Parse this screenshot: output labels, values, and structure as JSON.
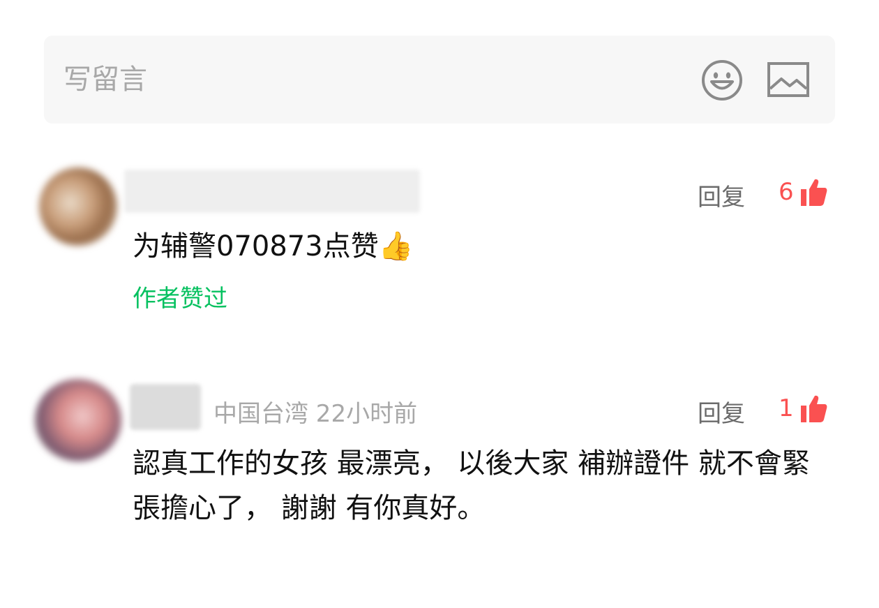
{
  "compose": {
    "placeholder": "写留言",
    "emoji_icon": "smiley-face-icon",
    "image_icon": "picture-icon"
  },
  "comments": [
    {
      "text": "为辅警070873点赞👍",
      "reply_label": "回复",
      "like_count": "6",
      "author_liked_label": "作者赞过"
    },
    {
      "location_time": "中国台湾 22小时前",
      "text": "認真工作的女孩 最漂亮， 以後大家 補辦證件 就不會緊張擔心了， 謝謝 有你真好。",
      "reply_label": "回复",
      "like_count": "1"
    }
  ],
  "colors": {
    "like_red": "#fa5151",
    "author_green": "#07c160",
    "secondary_gray": "#a8a8a8",
    "compose_bg": "#f7f7f7"
  }
}
